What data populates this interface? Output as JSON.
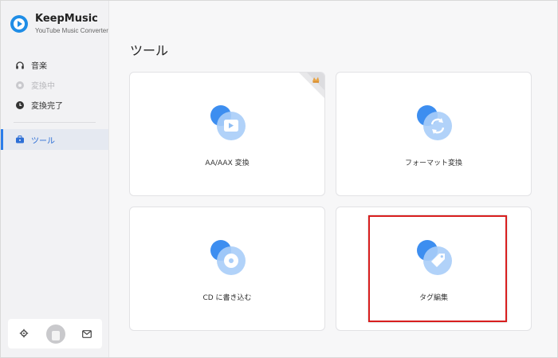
{
  "app": {
    "name": "KeepMusic",
    "subtitle": "YouTube Music Converter"
  },
  "sidebar": {
    "items": [
      {
        "label": "音楽",
        "icon": "headphones-icon",
        "state": "normal"
      },
      {
        "label": "変換中",
        "icon": "converting-icon",
        "state": "disabled"
      },
      {
        "label": "変換完了",
        "icon": "clock-icon",
        "state": "normal"
      },
      {
        "label": "ツール",
        "icon": "toolbox-icon",
        "state": "active"
      }
    ],
    "footer": {
      "settings_icon": "gear-icon",
      "avatar_icon": "avatar",
      "mail_icon": "mail-icon"
    }
  },
  "window_controls": {
    "menu": "≡",
    "minimize": "−",
    "maximize": "□",
    "close": "✕"
  },
  "main": {
    "title": "ツール",
    "tools": [
      {
        "label": "AA/AAX 変換",
        "icon": "video-play-icon",
        "badge": "crown-icon"
      },
      {
        "label": "フォーマット変換",
        "icon": "refresh-icon"
      },
      {
        "label": "CD に書き込む",
        "icon": "disc-icon"
      },
      {
        "label": "タグ編集",
        "icon": "tag-icon",
        "highlighted": true
      }
    ]
  },
  "colors": {
    "accent": "#2b7de9",
    "icon_blue_dark": "#3d8ef0",
    "icon_blue_light": "#a9cdf8",
    "highlight_red": "#d81e1e"
  }
}
